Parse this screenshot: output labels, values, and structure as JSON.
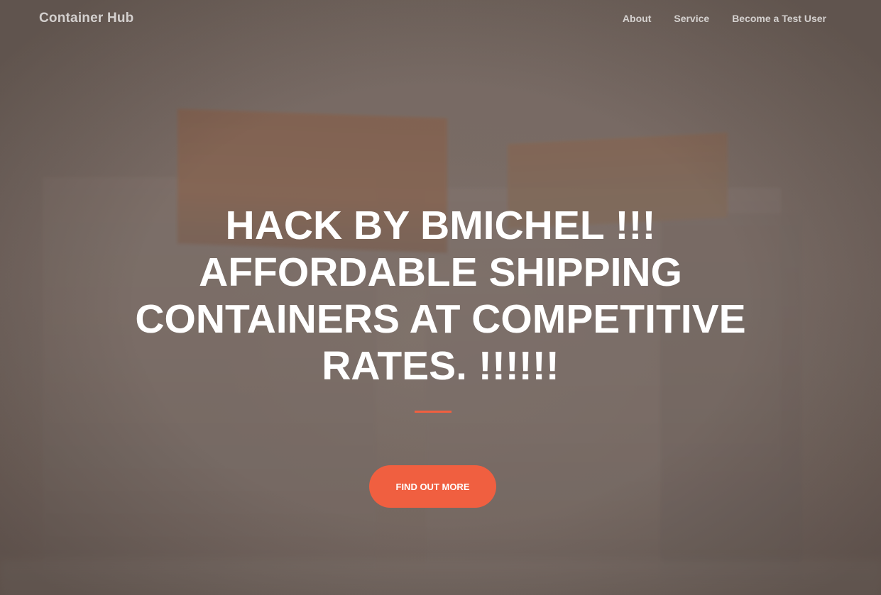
{
  "navbar": {
    "brand": "Container Hub",
    "links": [
      "About",
      "Service",
      "Become a Test User"
    ]
  },
  "hero": {
    "headline": "HACK BY BMICHEL !!! AFFORDABLE SHIPPING CONTAINERS AT COMPETITIVE RATES. !!!!!!",
    "cta_label": "FIND OUT MORE"
  },
  "colors": {
    "accent": "#f05f40",
    "text": "#ffffff"
  }
}
